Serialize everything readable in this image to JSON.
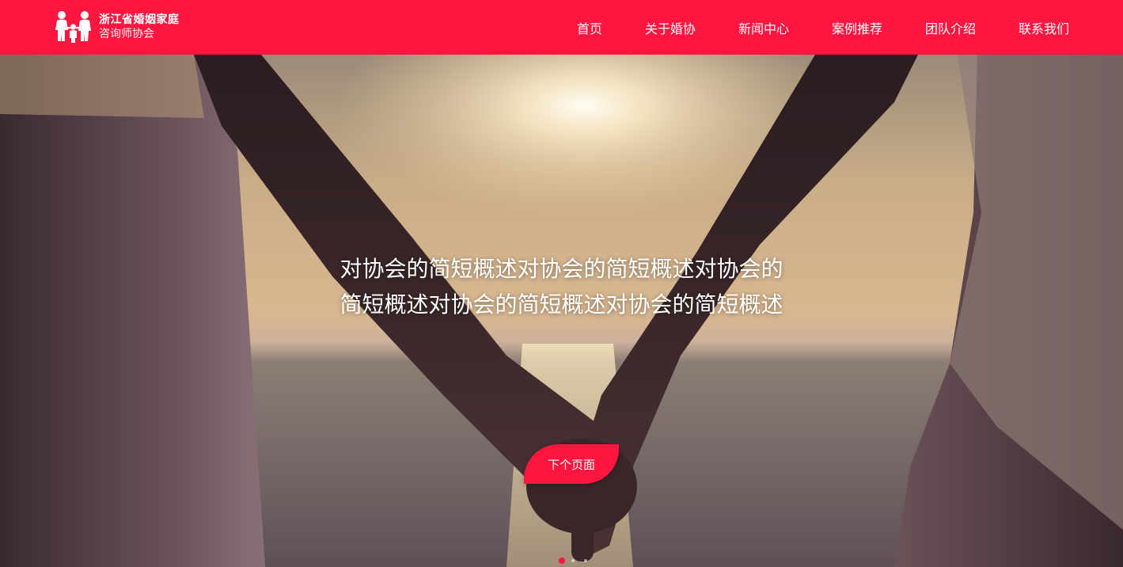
{
  "brand": {
    "line1": "浙江省婚姻家庭",
    "line2": "咨询师协会",
    "logo_icon": "family-figures-icon"
  },
  "nav": {
    "items": [
      {
        "label": "首页"
      },
      {
        "label": "关于婚协"
      },
      {
        "label": "新闻中心"
      },
      {
        "label": "案例推荐"
      },
      {
        "label": "团队介绍"
      },
      {
        "label": "联系我们"
      }
    ]
  },
  "hero": {
    "text_line1": "对协会的简短概述对协会的简短概述对协会的",
    "text_line2": "简短概述对协会的简短概述对协会的简短概述",
    "button_label": "下个页面",
    "slide_count": 3,
    "active_slide": 1
  },
  "colors": {
    "accent": "#ff1640",
    "text_on_accent": "#ffffff"
  }
}
